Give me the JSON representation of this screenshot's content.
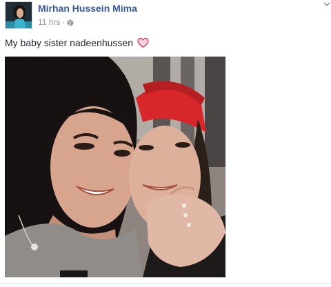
{
  "post": {
    "author_name": "Mirhan Hussein Mima",
    "timestamp": "11 hrs",
    "separator": "·",
    "privacy_icon": "globe-icon",
    "caption": "My baby sister nadeenhussen",
    "caption_emoji": "heart-emoji-icon",
    "menu_icon": "chevron-down-icon"
  },
  "colors": {
    "author_link": "#365899",
    "meta_text": "#90949c",
    "body_text": "#1d2129",
    "heart_outline": "#e0245e"
  }
}
